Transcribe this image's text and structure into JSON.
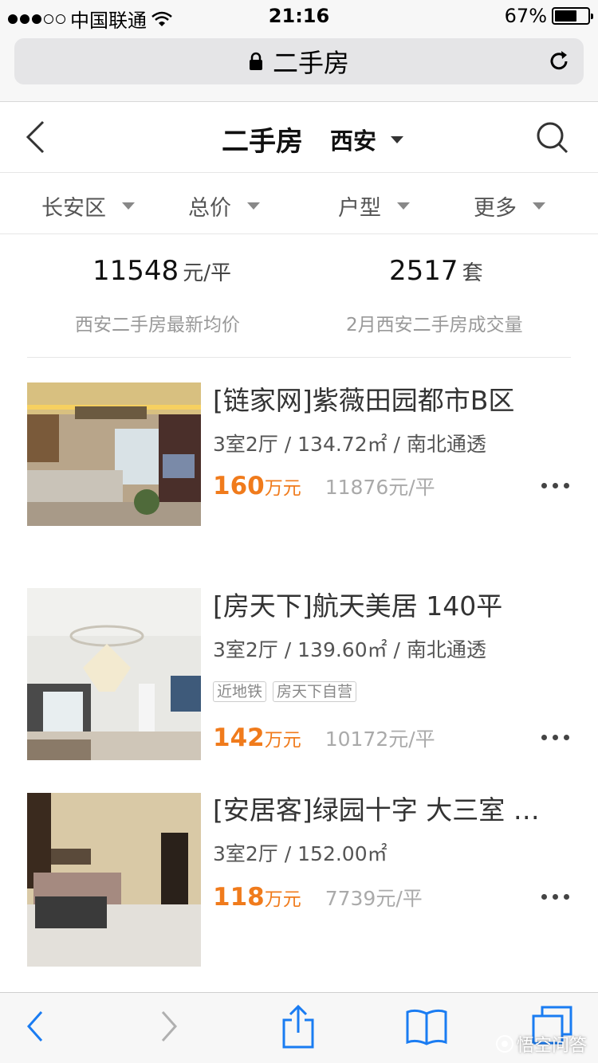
{
  "status_bar": {
    "carrier": "中国联通",
    "time": "21:16",
    "battery": "67%",
    "battery_level": 0.67
  },
  "browser": {
    "url_title": "二手房",
    "lock_icon": "lock-icon",
    "reload_icon": "reload-icon"
  },
  "header": {
    "title": "二手房",
    "city": "西安"
  },
  "filters": [
    {
      "label": "长安区"
    },
    {
      "label": "总价"
    },
    {
      "label": "户型"
    },
    {
      "label": "更多"
    }
  ],
  "stats": {
    "avg_price_value": "11548",
    "avg_price_unit": "元/平",
    "avg_price_label": "西安二手房最新均价",
    "volume_value": "2517",
    "volume_unit": "套",
    "volume_label": "2月西安二手房成交量"
  },
  "listings": [
    {
      "title": "[链家网]紫薇田园都市B区",
      "info": "3室2厅 / 134.72㎡ / 南北通透",
      "tags": [],
      "price": "160",
      "price_unit": "万元",
      "unit_price": "11876元/平"
    },
    {
      "title": "[房天下]航天美居 140平",
      "info": "3室2厅 / 139.60㎡ / 南北通透",
      "tags": [
        "近地铁",
        "房天下自营"
      ],
      "price": "142",
      "price_unit": "万元",
      "unit_price": "10172元/平"
    },
    {
      "title": "[安居客]绿园十字 大三室 …",
      "info": "3室2厅 / 152.00㎡",
      "tags": [],
      "price": "118",
      "price_unit": "万元",
      "unit_price": "7739元/平"
    }
  ],
  "watermark": "悟空问答",
  "colors": {
    "accent_price": "#f07b1c",
    "ios_blue": "#1a7cf2"
  }
}
